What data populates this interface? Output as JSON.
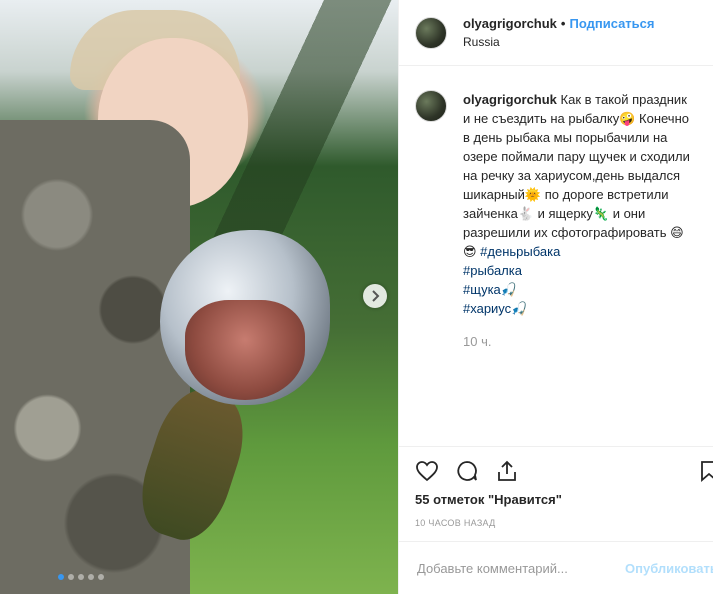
{
  "post": {
    "username": "olyagrigorchuk",
    "follow_label": "Подписаться",
    "separator": "•",
    "location": "Russia",
    "caption_parts": [
      "Как в такой праздник и не съездить на рыбалку🤪 Конечно в день рыбака мы порыбачили на озере поймали пару щучек и сходили на речку за хариусом,день выдался шикарный🌞 по дороге встретили зайченка🐇 и ящерку🦎 и они разрешили их сфотографировать 😄😎 "
    ],
    "inline_hashtag": "#деньрыбака",
    "hashtags": [
      "#рыбалка",
      "#щука🎣",
      "#хариус🎣"
    ],
    "comment_time": "10 ч.",
    "likes_text": "55 отметок \"Нравится\"",
    "posted_ago": "10 ЧАСОВ НАЗАД",
    "comment_placeholder": "Добавьте комментарий...",
    "publish_label": "Опубликовать"
  },
  "carousel": {
    "slides": 5,
    "active_index": 0,
    "accent": "#3897f0"
  },
  "icons": [
    "heart-icon",
    "comment-icon",
    "share-icon",
    "bookmark-icon",
    "chevron-right-icon"
  ]
}
